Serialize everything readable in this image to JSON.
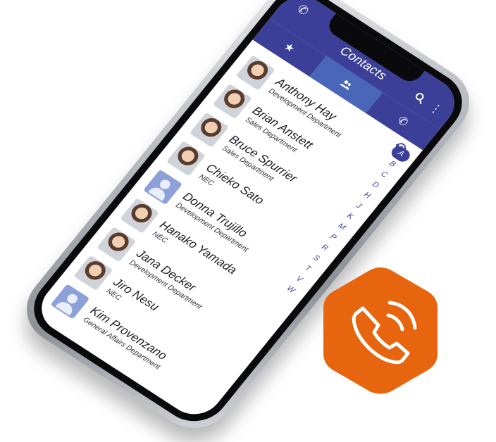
{
  "app": {
    "title": "Contacts"
  },
  "tabs": [
    {
      "name": "tab-favorites",
      "icon": "star-icon",
      "active": false
    },
    {
      "name": "tab-contacts",
      "icon": "people-icon",
      "active": true
    },
    {
      "name": "tab-calls",
      "icon": "phone-icon",
      "active": false
    }
  ],
  "contacts": [
    {
      "name": "Anthony Hay",
      "department": "Development Department",
      "avatar": "photo"
    },
    {
      "name": "Brian Anstett",
      "department": "Sales Department",
      "avatar": "photo"
    },
    {
      "name": "Bruce Spurrier",
      "department": "Sales Department",
      "avatar": "photo"
    },
    {
      "name": "Chieko Sato",
      "department": "NEC",
      "avatar": "photo"
    },
    {
      "name": "Donna Trujillo",
      "department": "Development Department",
      "avatar": "default"
    },
    {
      "name": "Hanako Yamada",
      "department": "NEC",
      "avatar": "photo"
    },
    {
      "name": "Jana Decker",
      "department": "Development Department",
      "avatar": "photo"
    },
    {
      "name": "Jiro Nesu",
      "department": "NEC",
      "avatar": "photo"
    },
    {
      "name": "Kim Provenzano",
      "department": "General Affairs Department",
      "avatar": "default"
    }
  ],
  "index_letters": [
    "A",
    "B",
    "C",
    "D",
    "H",
    "J",
    "K",
    "M",
    "P",
    "R",
    "S",
    "T",
    "V",
    "W"
  ],
  "index_active": "A",
  "colors": {
    "appbar": "#3b3f97",
    "active_tab": "#4a66b8",
    "badge": "#e86510",
    "badge_icon": "#ffffff"
  },
  "badge": {
    "icon": "phone-ringing-icon"
  }
}
